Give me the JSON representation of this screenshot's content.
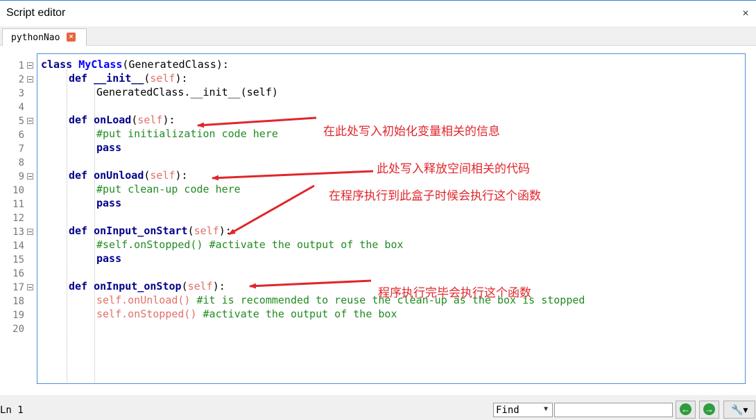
{
  "window": {
    "title": "Script editor",
    "close_glyph": "×"
  },
  "tab": {
    "label": "pythonNao",
    "close_glyph": "×"
  },
  "line_numbers": [
    "1",
    "2",
    "3",
    "4",
    "5",
    "6",
    "7",
    "8",
    "9",
    "10",
    "11",
    "12",
    "13",
    "14",
    "15",
    "16",
    "17",
    "18",
    "19",
    "20"
  ],
  "fold_lines": [
    1,
    2,
    5,
    9,
    13,
    17
  ],
  "code": {
    "l1_kw": "class",
    "l1_cls": "MyClass",
    "l1_rest": "(GeneratedClass):",
    "def_kw": "def",
    "self_kw": "self",
    "l2_fn": "__init__",
    "l2_open": "(",
    "l2_close": "):",
    "l3": "GeneratedClass.__init__(self)",
    "l5_fn": "onLoad",
    "l6": "#put initialization code here",
    "pass_kw": "pass",
    "l9_fn": "onUnload",
    "l10": "#put clean-up code here",
    "l13_fn": "onInput_onStart",
    "l14_code": "#self.onStopped()",
    "l14_cmt": "#activate the output of the box",
    "l17_fn": "onInput_onStop",
    "l18_call": ".onUnload()",
    "l18_cmt": "#it is recommended to reuse the clean-up as the box is stopped",
    "l19_call": ".onStopped()",
    "l19_cmt": "#activate the output of the box"
  },
  "annotations": {
    "onload": "在此处写入初始化变量相关的信息",
    "onunload": "此处写入释放空间相关的代码",
    "onstart": "在程序执行到此盒子时候会执行这个函数",
    "onstop": "程序执行完毕会执行这个函数"
  },
  "annotation_color": "#e0262b",
  "status": {
    "position": "Ln 1",
    "find_mode": "Find",
    "find_value": "",
    "prev_glyph": "←",
    "next_glyph": "→",
    "tools_glyph": "🔧▾"
  }
}
